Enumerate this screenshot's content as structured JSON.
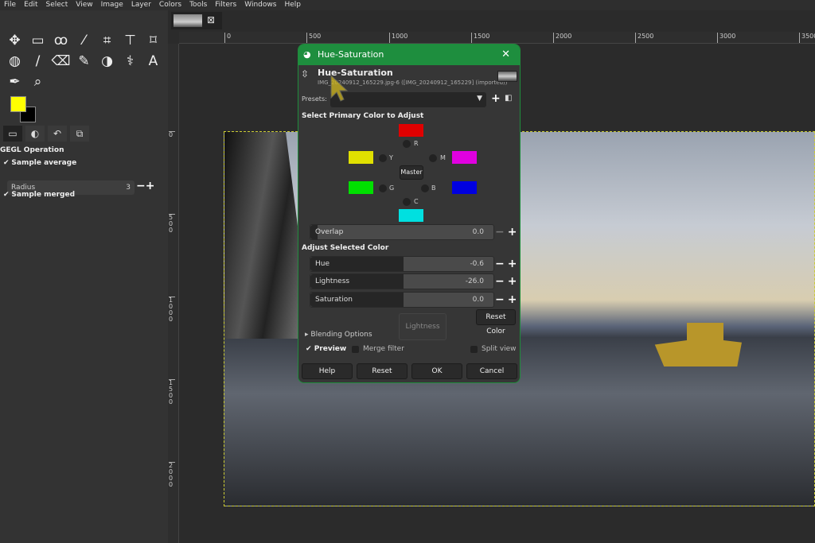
{
  "menu": [
    "File",
    "Edit",
    "Select",
    "View",
    "Image",
    "Layer",
    "Colors",
    "Tools",
    "Filters",
    "Windows",
    "Help"
  ],
  "tools": [
    "✥",
    "▭",
    "ꝏ",
    "⁄",
    "⌗",
    "⊤",
    "⌑",
    "◍",
    "/",
    "⌫",
    "✎",
    "◑",
    "⚕",
    "A",
    "✒",
    "⌕"
  ],
  "colors": {
    "foreground": "#ffff00",
    "background": "#000000",
    "accent": "#1e8e3e"
  },
  "tool_options": {
    "title": "GEGL Operation",
    "sample_average": "Sample average",
    "radius_label": "Radius",
    "radius_value": "3",
    "sample_merged": "Sample merged"
  },
  "rulers": {
    "h": [
      "0",
      "500",
      "1000",
      "1500",
      "2000",
      "2500",
      "3000",
      "3500"
    ],
    "v": [
      "0",
      "500",
      "1000",
      "1500",
      "2000"
    ]
  },
  "dialog": {
    "window_title": "Hue-Saturation",
    "heading": "Hue-Saturation",
    "subtitle": "IMG_20240912_165229.jpg-6 ([IMG_20240912_165229] (imported))",
    "presets_label": "Presets:",
    "presets_value": "",
    "select_primary": "Select Primary Color to Adjust",
    "primaries": {
      "R": "R",
      "Y": "Y",
      "M": "M",
      "G": "G",
      "B": "B",
      "C": "C"
    },
    "master": "Master",
    "overlap": {
      "label": "Overlap",
      "value": "0.0"
    },
    "adjust_selected": "Adjust Selected Color",
    "hue": {
      "label": "Hue",
      "value": "-0.6"
    },
    "lightness": {
      "label": "Lightness",
      "value": "-26.0"
    },
    "saturation": {
      "label": "Saturation",
      "value": "0.0"
    },
    "preview_label": "Lightness",
    "reset_color": "Reset Color",
    "blending_options": "Blending Options",
    "preview": "Preview",
    "merge_filter": "Merge filter",
    "split_view": "Split view",
    "help": "Help",
    "reset": "Reset",
    "ok": "OK",
    "cancel": "Cancel"
  }
}
